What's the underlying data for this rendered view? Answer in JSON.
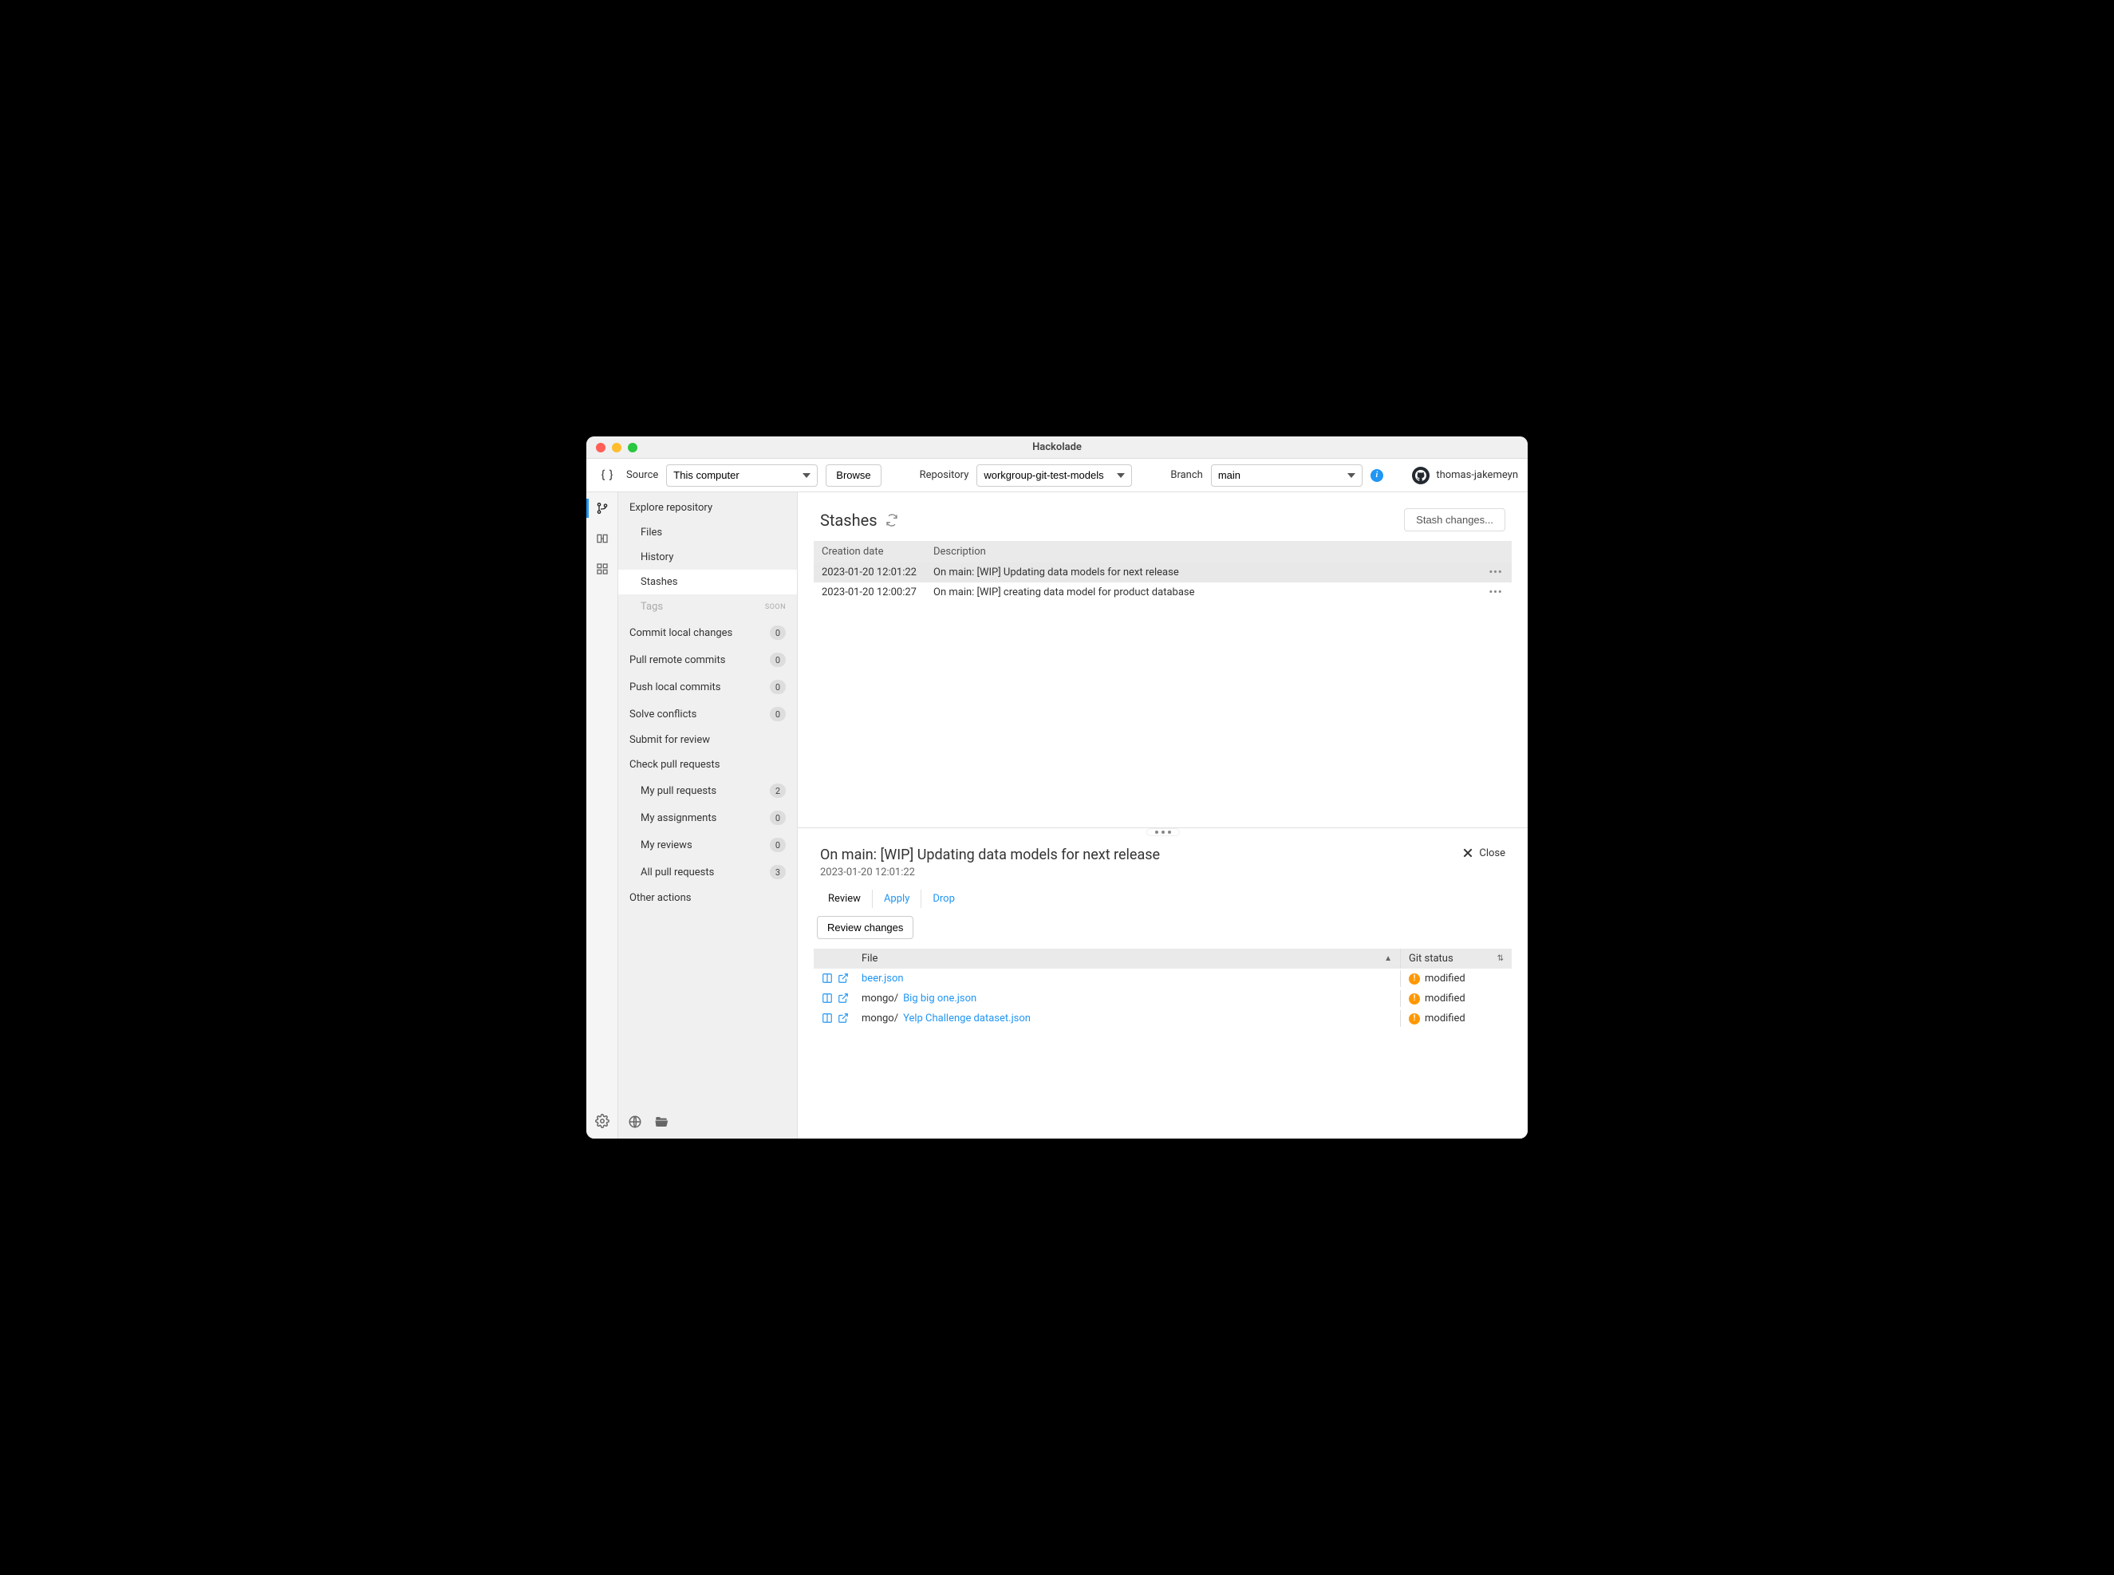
{
  "window": {
    "title": "Hackolade"
  },
  "toolbar": {
    "source_label": "Source",
    "source_value": "This computer",
    "browse_label": "Browse",
    "repo_label": "Repository",
    "repo_value": "workgroup-git-test-models",
    "branch_label": "Branch",
    "branch_value": "main",
    "username": "thomas-jakemeyn"
  },
  "sidebar": {
    "explore_title": "Explore repository",
    "files": "Files",
    "history": "History",
    "stashes": "Stashes",
    "tags": "Tags",
    "tags_soon": "SOON",
    "commit": {
      "label": "Commit local changes",
      "count": "0"
    },
    "pull": {
      "label": "Pull remote commits",
      "count": "0"
    },
    "push": {
      "label": "Push local commits",
      "count": "0"
    },
    "solve": {
      "label": "Solve conflicts",
      "count": "0"
    },
    "submit": "Submit for review",
    "check": "Check pull requests",
    "my_pr": {
      "label": "My pull requests",
      "count": "2"
    },
    "my_assign": {
      "label": "My assignments",
      "count": "0"
    },
    "my_reviews": {
      "label": "My reviews",
      "count": "0"
    },
    "all_pr": {
      "label": "All pull requests",
      "count": "3"
    },
    "other": "Other actions"
  },
  "stashes": {
    "title": "Stashes",
    "stash_btn": "Stash changes...",
    "col_date": "Creation date",
    "col_desc": "Description",
    "rows": [
      {
        "date": "2023-01-20 12:01:22",
        "desc": "On main: [WIP] Updating data models for next release"
      },
      {
        "date": "2023-01-20 12:00:27",
        "desc": "On main: [WIP] creating data model for product database"
      }
    ]
  },
  "detail": {
    "title": "On main: [WIP] Updating data models for next release",
    "date": "2023-01-20 12:01:22",
    "close": "Close",
    "tabs": {
      "review": "Review",
      "apply": "Apply",
      "drop": "Drop"
    },
    "review_btn": "Review changes",
    "col_file": "File",
    "col_status": "Git status",
    "files": [
      {
        "prefix": "",
        "name": "beer.json",
        "status": "modified"
      },
      {
        "prefix": "mongo/",
        "name": "Big big one.json",
        "status": "modified"
      },
      {
        "prefix": "mongo/",
        "name": "Yelp Challenge dataset.json",
        "status": "modified"
      }
    ]
  }
}
